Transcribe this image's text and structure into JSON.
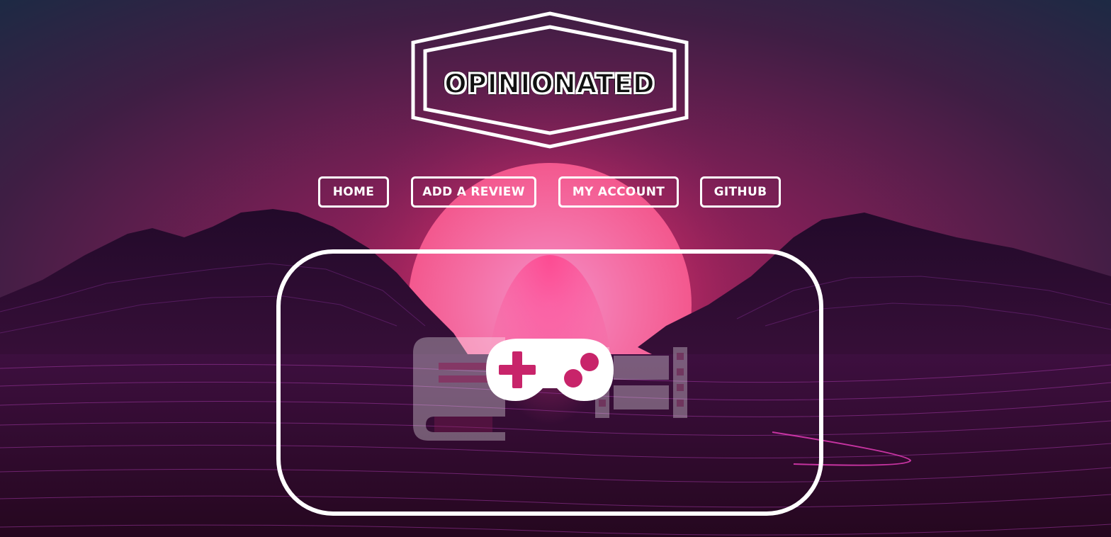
{
  "site": {
    "logo_text": "OPINIONATED"
  },
  "nav": {
    "items": [
      {
        "label": "HOME"
      },
      {
        "label": "ADD A REVIEW"
      },
      {
        "label": "MY ACCOUNT"
      },
      {
        "label": "GITHUB"
      }
    ]
  },
  "hero": {
    "icons": [
      "book-icon",
      "gamepad-icon",
      "film-icon"
    ]
  },
  "colors": {
    "background_top": "#1f2a44",
    "sky_magenta": "#6b1f52",
    "sun_pink": "#f56aa0",
    "accent_white": "#ffffff",
    "grid_line": "#b03ab0"
  }
}
